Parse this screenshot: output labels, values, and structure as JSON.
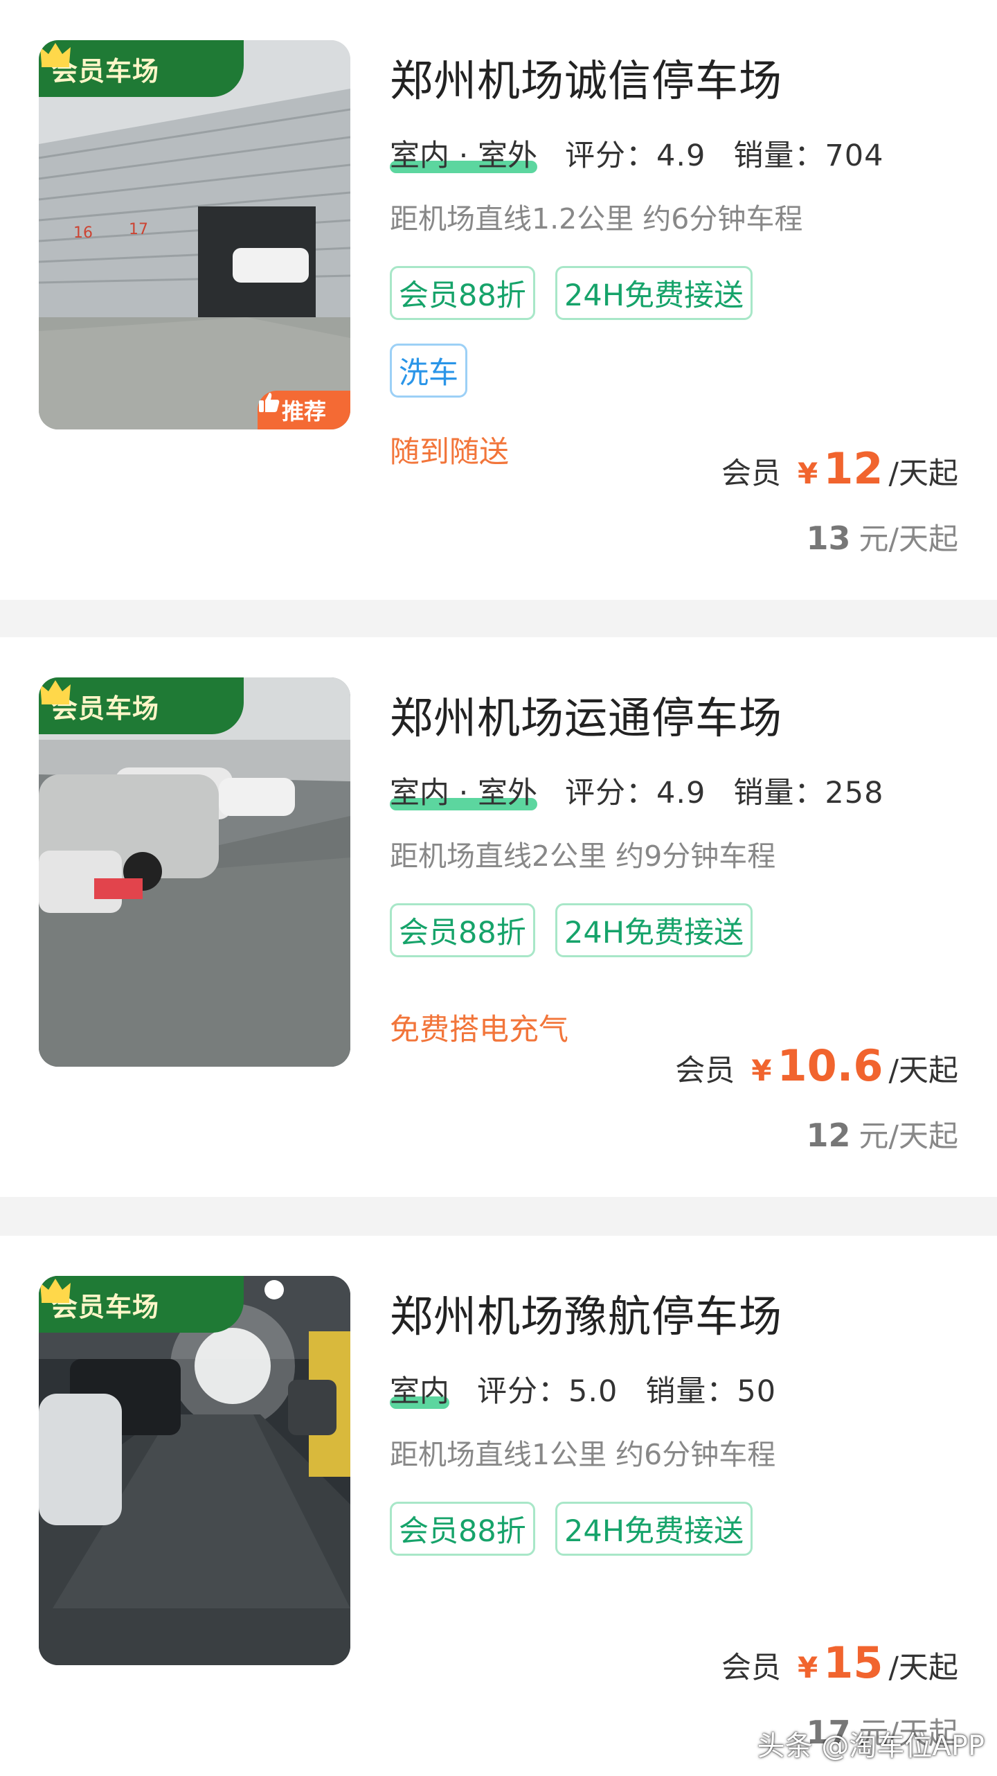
{
  "colors": {
    "accent_green": "#16a36a",
    "vip_flag": "#1f7a35",
    "price_orange": "#f1642e",
    "promo_orange": "#f2753a",
    "tag_blue": "#2a95e8"
  },
  "lots": [
    {
      "vip_label": "会员车场",
      "recommend_label": "推荐",
      "name": "郑州机场诚信停车场",
      "env": "室内 · 室外",
      "rating_label": "评分：",
      "rating": "4.9",
      "sales_label": "销量：",
      "sales": "704",
      "distance": "距机场直线1.2公里 约6分钟车程",
      "tags": [
        "会员88折",
        "24H免费接送",
        "洗车"
      ],
      "promo": "随到随送",
      "member_label": "会员",
      "currency": "¥",
      "member_price": "12",
      "unit": "/天起",
      "orig_price": "13",
      "orig_currency": "元"
    },
    {
      "vip_label": "会员车场",
      "name": "郑州机场运通停车场",
      "env": "室内 · 室外",
      "rating_label": "评分：",
      "rating": "4.9",
      "sales_label": "销量：",
      "sales": "258",
      "distance": "距机场直线2公里 约9分钟车程",
      "tags": [
        "会员88折",
        "24H免费接送"
      ],
      "promo": "免费搭电充气",
      "member_label": "会员",
      "currency": "¥",
      "member_price": "10.6",
      "unit": "/天起",
      "orig_price": "12",
      "orig_currency": "元"
    },
    {
      "vip_label": "会员车场",
      "name": "郑州机场豫航停车场",
      "env": "室内",
      "rating_label": "评分：",
      "rating": "5.0",
      "sales_label": "销量：",
      "sales": "50",
      "distance": "距机场直线1公里 约6分钟车程",
      "tags": [
        "会员88折",
        "24H免费接送"
      ],
      "member_label": "会员",
      "currency": "¥",
      "member_price": "15",
      "unit": "/天起",
      "orig_price": "17",
      "orig_currency": "元"
    }
  ],
  "watermark": "头条 @淘车位APP"
}
